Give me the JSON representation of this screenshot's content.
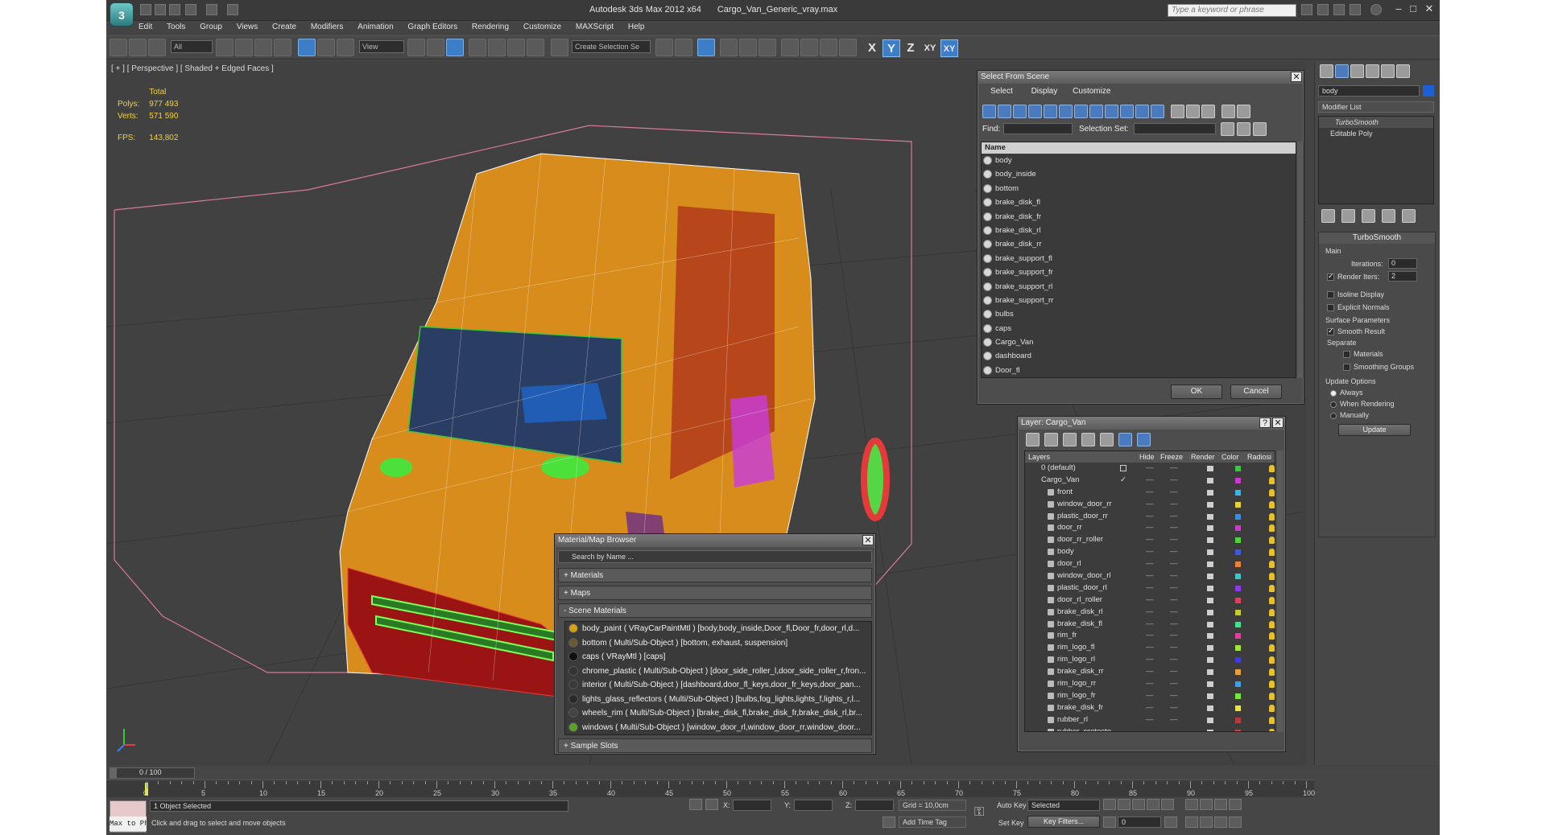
{
  "app": {
    "title_app": "Autodesk 3ds Max  2012 x64",
    "title_file": "Cargo_Van_Generic_vray.max",
    "search_placeholder": "Type a keyword or phrase",
    "logo_text": "3"
  },
  "menu": [
    "Edit",
    "Tools",
    "Group",
    "Views",
    "Create",
    "Modifiers",
    "Animation",
    "Graph Editors",
    "Rendering",
    "Customize",
    "MAXScript",
    "Help"
  ],
  "toolbar": {
    "filter_value": "All",
    "refcoord_value": "View",
    "named_selection_placeholder": "Create Selection Se",
    "axis_x": "X",
    "axis_y": "Y",
    "axis_z": "Z",
    "axis_xy": "XY",
    "axis_xy2": "XY"
  },
  "viewport": {
    "label": "[ + ] [ Perspective ] [ Shaded + Edged Faces ]",
    "stats_total": "Total",
    "polys_label": "Polys:",
    "polys_value": "977 493",
    "verts_label": "Verts:",
    "verts_value": "571 590",
    "fps_label": "FPS:",
    "fps_value": "143,802"
  },
  "select_from_scene": {
    "title": "Select From Scene",
    "tabs": [
      "Select",
      "Display",
      "Customize"
    ],
    "find_label": "Find:",
    "selection_set_label": "Selection Set:",
    "column_name": "Name",
    "items": [
      "body",
      "body_inside",
      "bottom",
      "brake_disk_fl",
      "brake_disk_fr",
      "brake_disk_rl",
      "brake_disk_rr",
      "brake_support_fl",
      "brake_support_fr",
      "brake_support_rl",
      "brake_support_rr",
      "bulbs",
      "caps",
      "Cargo_Van",
      "dashboard",
      "Door_fl"
    ],
    "ok_label": "OK",
    "cancel_label": "Cancel"
  },
  "layer_panel": {
    "title": "Layer: Cargo_Van",
    "columns": [
      "Layers",
      "Hide",
      "Freeze",
      "Render",
      "Color",
      "Radiosi"
    ],
    "root_layers": [
      "0 (default)",
      "Cargo_Van"
    ],
    "items": [
      {
        "name": "front",
        "color": "#3cb4e6"
      },
      {
        "name": "window_door_rr",
        "color": "#e6d23c"
      },
      {
        "name": "plastic_door_rr",
        "color": "#3c8ce6"
      },
      {
        "name": "door_rr",
        "color": "#c83cc8"
      },
      {
        "name": "door_rr_roller",
        "color": "#50d23c"
      },
      {
        "name": "body",
        "color": "#3c5ae6"
      },
      {
        "name": "door_rl",
        "color": "#e6823c"
      },
      {
        "name": "window_door_rl",
        "color": "#3cc8c8"
      },
      {
        "name": "plastic_door_rl",
        "color": "#8c3ce6"
      },
      {
        "name": "door_rl_roller",
        "color": "#e63c5a"
      },
      {
        "name": "brake_disk_rl",
        "color": "#c8c83c"
      },
      {
        "name": "brake_disk_fl",
        "color": "#3ce68c"
      },
      {
        "name": "rim_fr",
        "color": "#e63ca0"
      },
      {
        "name": "rim_logo_fl",
        "color": "#a0e63c"
      },
      {
        "name": "rim_logo_rl",
        "color": "#3c3ce6"
      },
      {
        "name": "brake_disk_rr",
        "color": "#e6a03c"
      },
      {
        "name": "rim_logo_rr",
        "color": "#3ca0e6"
      },
      {
        "name": "rim_logo_fr",
        "color": "#78e63c"
      },
      {
        "name": "brake_disk_fr",
        "color": "#e6e63c"
      },
      {
        "name": "rubber_rl",
        "color": "#b43c3c"
      },
      {
        "name": "rubber_protecto",
        "color": "#e63c3c"
      }
    ]
  },
  "material_browser": {
    "title": "Material/Map Browser",
    "search_placeholder": "Search by Name ...",
    "sections": {
      "materials": "+ Materials",
      "maps": "+ Maps",
      "scene_materials": "- Scene Materials",
      "sample_slots": "+ Sample Slots"
    },
    "scene_materials": [
      {
        "text": "body_paint  ( VRayCarPaintMtl ) [body,body_inside,Door_fl,Door_fr,door_rl,d...",
        "color": "#d4a017"
      },
      {
        "text": "bottom  ( Multi/Sub-Object ) [bottom, exhaust, suspension]",
        "color": "#6b5a3a"
      },
      {
        "text": "caps  ( VRayMtl ) [caps]",
        "color": "#111111"
      },
      {
        "text": "chrome_plastic ( Multi/Sub-Object ) [door_side_roller_l,door_side_roller_r,fron...",
        "color": "#333333"
      },
      {
        "text": "interior  ( Multi/Sub-Object ) [dashboard,door_fl_keys,door_fr_keys,door_pan...",
        "color": "#3a3a3a"
      },
      {
        "text": "lights_glass_reflectors  ( Multi/Sub-Object ) [bulbs,fog_lights,lights_f,lights_r,l...",
        "color": "#2a2a2a"
      },
      {
        "text": "wheels_rim  ( Multi/Sub-Object ) [brake_disk_fl,brake_disk_fr,brake_disk_rl,br...",
        "color": "#444444"
      },
      {
        "text": "windows  ( Multi/Sub-Object ) [window_door_rl,window_door_rr,window_door...",
        "color": "#5aa02a"
      }
    ]
  },
  "command_panel": {
    "object_name": "body",
    "modifier_list": "Modifier List",
    "stack": [
      "TurboSmooth",
      "Editable Poly"
    ],
    "rollout_title": "TurboSmooth",
    "main_label": "Main",
    "iterations_label": "Iterations:",
    "iterations_value": "0",
    "render_iters_label": "Render Iters:",
    "render_iters_value": "2",
    "isoline_label": "Isoline Display",
    "explicit_label": "Explicit Normals",
    "surface_label": "Surface Parameters",
    "smooth_label": "Smooth Result",
    "separate_label": "Separate",
    "materials_label": "Materials",
    "smoothing_label": "Smoothing Groups",
    "update_options_label": "Update Options",
    "always_label": "Always",
    "when_rendering_label": "When Rendering",
    "manually_label": "Manually",
    "update_button": "Update"
  },
  "timeline": {
    "frame_display": "0 / 100",
    "ticks": [
      "0",
      "5",
      "10",
      "15",
      "20",
      "25",
      "30",
      "35",
      "40",
      "45",
      "50",
      "55",
      "60",
      "65",
      "70",
      "75",
      "80",
      "85",
      "90",
      "95",
      "100"
    ]
  },
  "status": {
    "maxscript": "Max to Physc",
    "selection": "1 Object Selected",
    "prompt": "Click and drag to select and move objects",
    "x_label": "X:",
    "y_label": "Y:",
    "z_label": "Z:",
    "grid": "Grid = 10,0cm",
    "add_time_tag": "Add Time Tag",
    "auto_key": "Auto Key",
    "set_key": "Set Key",
    "key_mode": "Selected",
    "key_filters": "Key Filters...",
    "frame_value": "0"
  }
}
